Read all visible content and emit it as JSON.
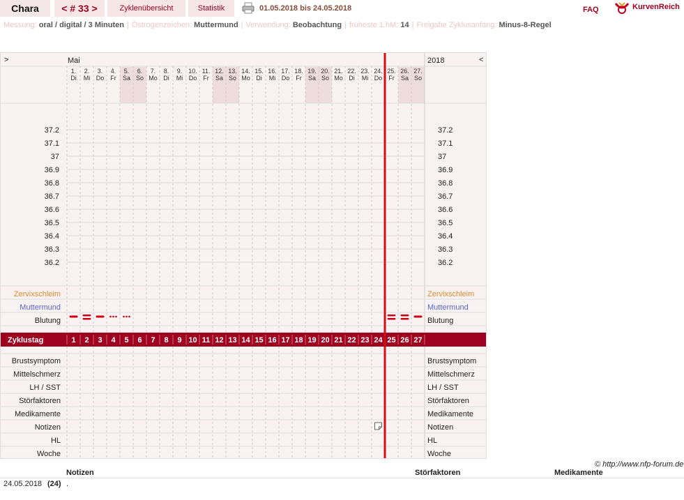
{
  "header": {
    "user": "Chara",
    "cycle_label": "< # 33 >",
    "overview_label": "Zyklenübersicht",
    "stats_label": "Statistik",
    "range": "01.05.2018 bis 24.05.2018",
    "faq": "FAQ",
    "brand": "KurvenReich",
    "icons": [
      "printer-icon",
      "kurvenreich-logo"
    ]
  },
  "info": [
    {
      "label": "Messung:",
      "value": "oral / digital / 3 Minuten"
    },
    {
      "label": "Östrogenzeichen:",
      "value": "Muttermund"
    },
    {
      "label": "Verwendung:",
      "value": "Beobachtung"
    },
    {
      "label": "früheste 1.hM:",
      "value": "14"
    },
    {
      "label": "Freigabe Zyklusanfang:",
      "value": "Minus-8-Regel"
    }
  ],
  "chart": {
    "nav_prev": ">",
    "nav_next": "<",
    "month": "Mai",
    "year": "2018",
    "days": [
      {
        "d": "1.",
        "w": "Di",
        "we": false
      },
      {
        "d": "2.",
        "w": "Mi",
        "we": false
      },
      {
        "d": "3.",
        "w": "Do",
        "we": false
      },
      {
        "d": "4.",
        "w": "Fr",
        "we": false
      },
      {
        "d": "5.",
        "w": "Sa",
        "we": true
      },
      {
        "d": "6.",
        "w": "So",
        "we": true
      },
      {
        "d": "7.",
        "w": "Mo",
        "we": false
      },
      {
        "d": "8.",
        "w": "Di",
        "we": false
      },
      {
        "d": "9.",
        "w": "Mi",
        "we": false
      },
      {
        "d": "10.",
        "w": "Do",
        "we": false
      },
      {
        "d": "11.",
        "w": "Fr",
        "we": false
      },
      {
        "d": "12.",
        "w": "Sa",
        "we": true
      },
      {
        "d": "13.",
        "w": "So",
        "we": true
      },
      {
        "d": "14.",
        "w": "Mo",
        "we": false
      },
      {
        "d": "15.",
        "w": "Di",
        "we": false
      },
      {
        "d": "16.",
        "w": "Mi",
        "we": false
      },
      {
        "d": "17.",
        "w": "Do",
        "we": false
      },
      {
        "d": "18.",
        "w": "Fr",
        "we": false
      },
      {
        "d": "19.",
        "w": "Sa",
        "we": true
      },
      {
        "d": "20.",
        "w": "So",
        "we": true
      },
      {
        "d": "21.",
        "w": "Mo",
        "we": false
      },
      {
        "d": "22.",
        "w": "Di",
        "we": false
      },
      {
        "d": "23.",
        "w": "Mi",
        "we": false
      },
      {
        "d": "24.",
        "w": "Do",
        "we": false
      },
      {
        "d": "25.",
        "w": "Fr",
        "we": false
      },
      {
        "d": "26.",
        "w": "Sa",
        "we": true
      },
      {
        "d": "27.",
        "w": "So",
        "we": true
      }
    ],
    "temps": [
      "37.2",
      "37.1",
      "37",
      "36.9",
      "36.8",
      "36.7",
      "36.6",
      "36.5",
      "36.4",
      "36.3",
      "36.2"
    ],
    "temp_rows": [
      {
        "label": "Zervixschleim",
        "color": "#e08a2a"
      },
      {
        "label": "Muttermund",
        "color": "#5566cc"
      },
      {
        "label": "Blutung",
        "color": "#222222"
      }
    ],
    "bleeding": [
      {
        "day": 1,
        "type": "dash1"
      },
      {
        "day": 2,
        "type": "dash2"
      },
      {
        "day": 3,
        "type": "dash1"
      },
      {
        "day": 4,
        "type": "dots"
      },
      {
        "day": 5,
        "type": "dots"
      },
      {
        "day": 25,
        "type": "dash2"
      },
      {
        "day": 26,
        "type": "dash2"
      },
      {
        "day": 27,
        "type": "dash1"
      }
    ],
    "cycle_label": "Zyklustag",
    "cycle_days": [
      "1",
      "2",
      "3",
      "4",
      "5",
      "6",
      "7",
      "8",
      "9",
      "10",
      "11",
      "12",
      "13",
      "14",
      "15",
      "16",
      "17",
      "18",
      "19",
      "20",
      "21",
      "22",
      "23",
      "24",
      "25",
      "26",
      "27"
    ],
    "lower_rows": [
      "Brustsymptom",
      "Mittelschmerz",
      "LH / SST",
      "Störfaktoren",
      "Medikamente",
      "Notizen",
      "HL",
      "Woche"
    ],
    "note_icon_day": 24,
    "today_day": 24,
    "accent": "#a00020",
    "today_line": "#d21010"
  },
  "copyright": "© http://www.nfp-forum.de",
  "notes_table": {
    "headers": [
      "Notizen",
      "Störfaktoren",
      "Medikamente"
    ],
    "rows": [
      {
        "date": "24.05.2018",
        "day": "(24)",
        "note": "."
      }
    ]
  }
}
